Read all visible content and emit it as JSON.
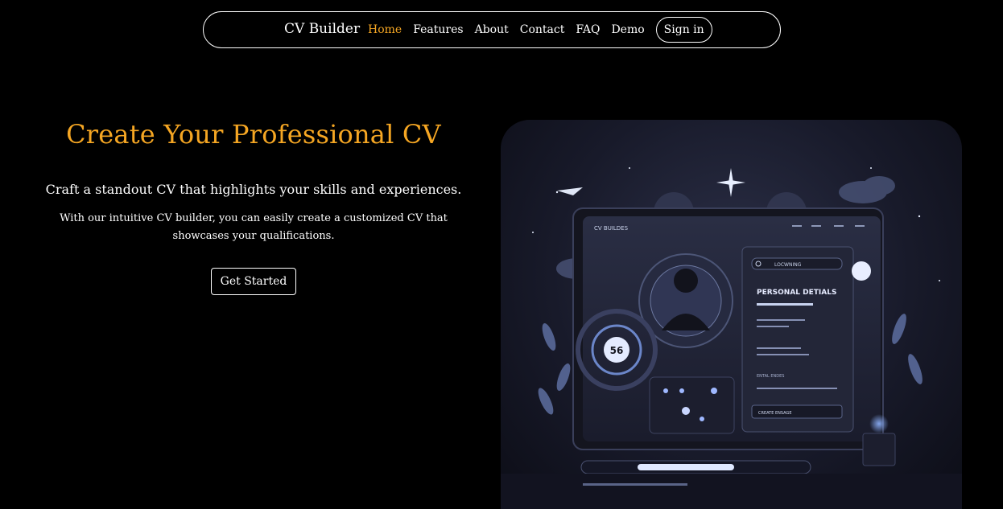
{
  "nav": {
    "brand": "CV Builder",
    "links": [
      {
        "label": "Home",
        "active": true
      },
      {
        "label": "Features",
        "active": false
      },
      {
        "label": "About",
        "active": false
      },
      {
        "label": "Contact",
        "active": false
      },
      {
        "label": "FAQ",
        "active": false
      },
      {
        "label": "Demo",
        "active": false
      }
    ],
    "signin": "Sign in"
  },
  "hero": {
    "title": "Create Your Professional CV",
    "subtitle": "Craft a standout CV that highlights your skills and experiences.",
    "description": "With our intuitive CV builder, you can easily create a customized CV that showcases your qualifications.",
    "cta": "Get Started"
  },
  "illustration": {
    "app_name": "CV BUILDES",
    "panel_heading": "PERSONAL DETIALS",
    "search_label": "LOCWNING",
    "badge_number": "56",
    "button_label": "CREATE ENSAGE",
    "section_label": "ENTAL ENDES",
    "accent": "#f5a623"
  }
}
